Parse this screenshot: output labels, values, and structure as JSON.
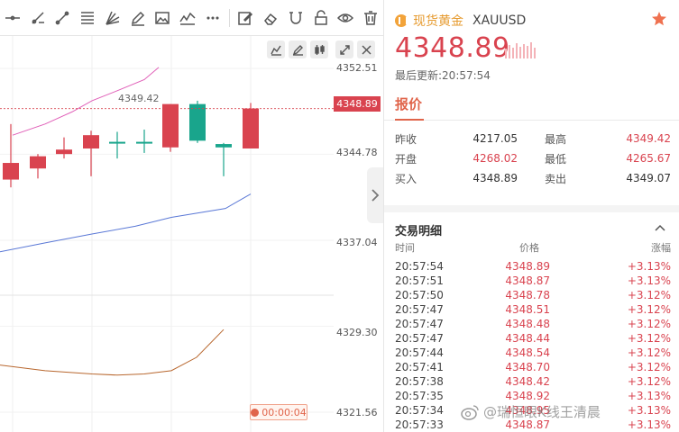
{
  "symbol": {
    "name": "现货黄金",
    "code": "XAUUSD"
  },
  "last_price": "4348.89",
  "update_time": "最后更新:20:57:54",
  "tabs": {
    "quote": "报价"
  },
  "quote": {
    "rows": [
      {
        "l1": "昨收",
        "v1": "4217.05",
        "v1_red": false,
        "l2": "最高",
        "v2": "4349.42",
        "v2_red": true
      },
      {
        "l1": "开盘",
        "v1": "4268.02",
        "v1_red": true,
        "l2": "最低",
        "v2": "4265.67",
        "v2_red": true
      },
      {
        "l1": "买入",
        "v1": "4348.89",
        "v1_red": false,
        "l2": "卖出",
        "v2": "4349.07",
        "v2_red": false
      }
    ]
  },
  "trades": {
    "title": "交易明细",
    "headers": {
      "time": "时间",
      "price": "价格",
      "change": "涨幅"
    },
    "rows": [
      [
        "20:57:54",
        "4348.89",
        "+3.13%"
      ],
      [
        "20:57:51",
        "4348.87",
        "+3.13%"
      ],
      [
        "20:57:50",
        "4348.78",
        "+3.12%"
      ],
      [
        "20:57:47",
        "4348.51",
        "+3.12%"
      ],
      [
        "20:57:47",
        "4348.48",
        "+3.12%"
      ],
      [
        "20:57:47",
        "4348.44",
        "+3.12%"
      ],
      [
        "20:57:44",
        "4348.54",
        "+3.12%"
      ],
      [
        "20:57:41",
        "4348.70",
        "+3.12%"
      ],
      [
        "20:57:38",
        "4348.42",
        "+3.12%"
      ],
      [
        "20:57:35",
        "4348.92",
        "+3.13%"
      ],
      [
        "20:57:34",
        "4348.95",
        "+3.13%"
      ],
      [
        "20:57:33",
        "4348.87",
        "+3.13%"
      ]
    ]
  },
  "chart": {
    "price_tag": "4348.89",
    "peak_label": "4349.42",
    "timer": "00:00:04",
    "axis": [
      "4352.51",
      "4344.78",
      "4337.04",
      "4329.30",
      "4321.56"
    ]
  },
  "chart_data": {
    "type": "candlestick",
    "yaxis_ticks": [
      4352.51,
      4344.78,
      4337.04,
      4329.3,
      4321.56
    ],
    "candles": [
      {
        "open": 4344.0,
        "close": 4342.5,
        "high": 4347.5,
        "low": 4341.8,
        "dir": "down"
      },
      {
        "open": 4344.6,
        "close": 4343.5,
        "high": 4344.8,
        "low": 4342.6,
        "dir": "down"
      },
      {
        "open": 4345.2,
        "close": 4344.8,
        "high": 4346.3,
        "low": 4344.4,
        "dir": "down"
      },
      {
        "open": 4346.5,
        "close": 4345.3,
        "high": 4346.9,
        "low": 4342.8,
        "dir": "down"
      },
      {
        "open": 4345.8,
        "close": 4345.9,
        "high": 4346.8,
        "low": 4344.4,
        "dir": "up"
      },
      {
        "open": 4345.8,
        "close": 4345.9,
        "high": 4347.0,
        "low": 4344.9,
        "dir": "up"
      },
      {
        "open": 4349.3,
        "close": 4345.4,
        "high": 4349.3,
        "low": 4345.0,
        "dir": "down"
      },
      {
        "open": 4346.0,
        "close": 4349.3,
        "high": 4349.6,
        "low": 4345.8,
        "dir": "up"
      },
      {
        "open": 4345.7,
        "close": 4345.4,
        "high": 4345.8,
        "low": 4342.8,
        "dir": "up"
      },
      {
        "open": 4348.9,
        "close": 4345.3,
        "high": 4349.4,
        "low": 4345.3,
        "dir": "down"
      }
    ],
    "ma_lines": [
      {
        "color": "#e05fb8",
        "values": [
          4346.5,
          4347.5,
          4348.6,
          4349.6,
          4350.5,
          4351.5,
          4352.6
        ]
      },
      {
        "color": "#5a78d6",
        "values": [
          4336.0,
          4336.8,
          4337.6,
          4338.3,
          4339.1,
          4339.9,
          4341.2
        ]
      },
      {
        "color": "#b8672e",
        "values": [
          4325.8,
          4325.3,
          4325.0,
          4324.9,
          4325.0,
          4325.3,
          4326.5,
          4329.0
        ]
      }
    ]
  }
}
